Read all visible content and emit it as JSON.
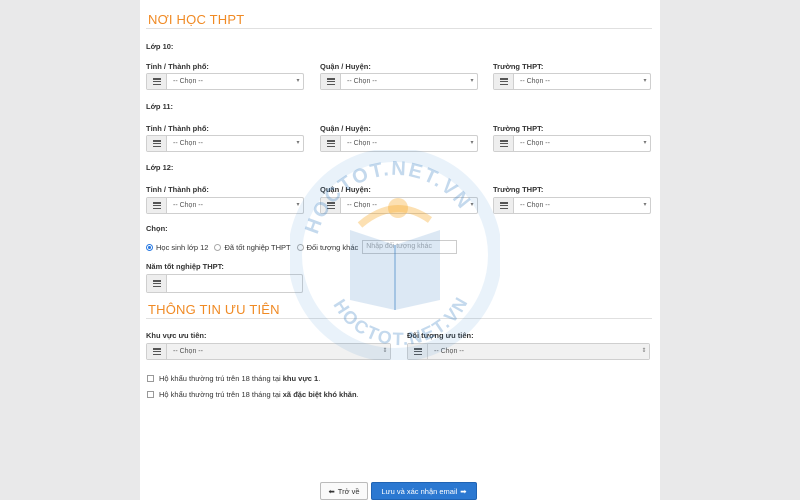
{
  "section_school": {
    "title": "NƠI HỌC THPT"
  },
  "col_labels": {
    "city": "Tỉnh / Thành phố:",
    "district": "Quận / Huyện:",
    "school": "Trường THPT:"
  },
  "grades": [
    {
      "label": "Lớp 10:"
    },
    {
      "label": "Lớp 11:"
    },
    {
      "label": "Lớp 12:"
    }
  ],
  "select_placeholder": "-- Chọn --",
  "choice": {
    "label": "Chọn:",
    "options": [
      "Học sinh lớp 12",
      "Đã tốt nghiệp THPT",
      "Đối tượng khác"
    ],
    "selected": "Học sinh lớp 12",
    "other_placeholder": "Nhập đối tượng khác"
  },
  "graduation_year": {
    "label": "Năm tốt nghiệp THPT:",
    "value": ""
  },
  "section_priority": {
    "title": "THÔNG TIN ƯU TIÊN",
    "region_label": "Khu vực ưu tiên:",
    "object_label": "Đối tượng ưu tiên:"
  },
  "checkboxes": [
    {
      "prefix": "Hộ khẩu thường trú trên 18 tháng tại ",
      "bold": "khu vực 1",
      "suffix": "."
    },
    {
      "prefix": "Hộ khẩu thường trú trên 18 tháng tại ",
      "bold": "xã đặc biệt khó khăn",
      "suffix": "."
    }
  ],
  "buttons": {
    "back": "Trở về",
    "save": "Lưu và xác nhận email"
  },
  "watermark": {
    "text": "HOCTOT.NET.VN"
  },
  "colors": {
    "accent": "#f08a24",
    "primary": "#2b78d1",
    "radio": "#2a7ae2"
  }
}
